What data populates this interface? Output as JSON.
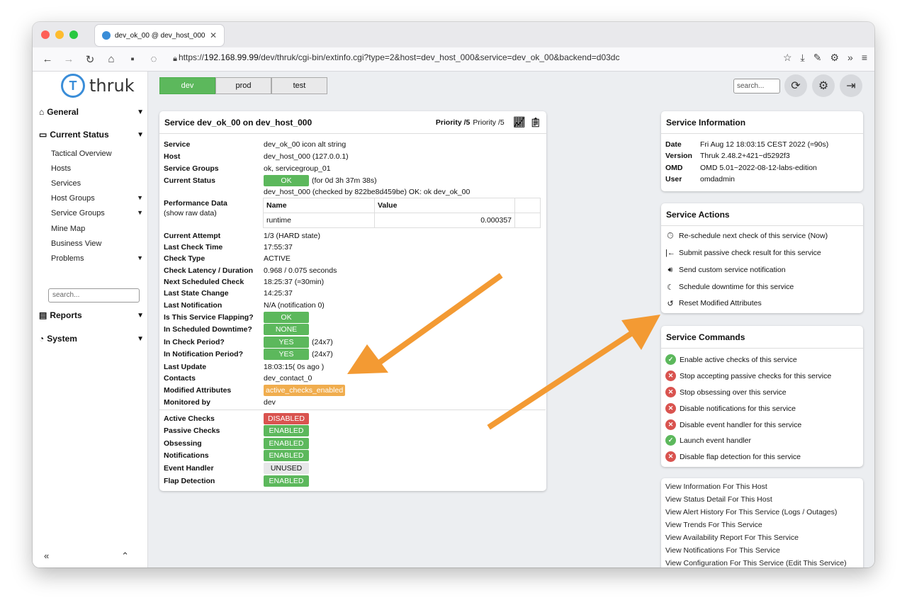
{
  "browser": {
    "tab_title": "dev_ok_00 @ dev_host_000",
    "url_prefix": "https://",
    "url_host": "192.168.99.99",
    "url_path": "/dev/thruk/cgi-bin/extinfo.cgi?type=2&host=dev_host_000&service=dev_ok_00&backend=d03dc"
  },
  "logo": {
    "text": "thruk"
  },
  "sidebar": {
    "sections": [
      {
        "label": "General"
      },
      {
        "label": "Current Status"
      },
      {
        "label": "Reports"
      },
      {
        "label": "System"
      }
    ],
    "items": [
      {
        "label": "Tactical Overview"
      },
      {
        "label": "Hosts"
      },
      {
        "label": "Services"
      },
      {
        "label": "Host Groups"
      },
      {
        "label": "Service Groups"
      },
      {
        "label": "Mine Map"
      },
      {
        "label": "Business View"
      },
      {
        "label": "Problems"
      }
    ],
    "search_placeholder": "search..."
  },
  "backends": [
    "dev",
    "prod",
    "test"
  ],
  "header_search_placeholder": "search...",
  "service_card": {
    "title": "Service dev_ok_00 on dev_host_000",
    "priority_bold": "Priority /5",
    "priority_plain": "Priority /5",
    "rows": {
      "service": {
        "label": "Service",
        "value": "dev_ok_00  icon alt string"
      },
      "host": {
        "label": "Host",
        "value": "dev_host_000 (127.0.0.1)"
      },
      "groups": {
        "label": "Service Groups",
        "value": "ok, servicegroup_01"
      },
      "status": {
        "label": "Current Status",
        "badge": "OK",
        "extra": "(for 0d 3h 37m 38s)",
        "output": "dev_host_000 (checked by 822be8d459be) OK: ok dev_ok_00"
      },
      "perf": {
        "label": "Performance Data",
        "sublabel": "(show raw data)",
        "col_name": "Name",
        "col_value": "Value",
        "name": "runtime",
        "value": "0.000357"
      },
      "attempt": {
        "label": "Current Attempt",
        "value": "1/3 (HARD state)"
      },
      "last_check": {
        "label": "Last Check Time",
        "value": "17:55:37"
      },
      "check_type": {
        "label": "Check Type",
        "value": "ACTIVE"
      },
      "latency": {
        "label": "Check Latency / Duration",
        "value": "0.968 / 0.075 seconds"
      },
      "next_check": {
        "label": "Next Scheduled Check",
        "value": "18:25:37 (≈30min)"
      },
      "last_change": {
        "label": "Last State Change",
        "value": "14:25:37"
      },
      "last_notif": {
        "label": "Last Notification",
        "value": "N/A (notification 0)"
      },
      "flapping": {
        "label": "Is This Service Flapping?",
        "badge": "OK"
      },
      "downtime": {
        "label": "In Scheduled Downtime?",
        "badge": "NONE"
      },
      "check_period": {
        "label": "In Check Period?",
        "badge": "YES",
        "extra": "(24x7)"
      },
      "notif_period": {
        "label": "In Notification Period?",
        "badge": "YES",
        "extra": "(24x7)"
      },
      "last_update": {
        "label": "Last Update",
        "value": "18:03:15( 0s ago )"
      },
      "contacts": {
        "label": "Contacts",
        "value": "dev_contact_0"
      },
      "modified": {
        "label": "Modified Attributes",
        "badge": "active_checks_enabled"
      },
      "monitored": {
        "label": "Monitored by",
        "value": "dev"
      },
      "active_checks": {
        "label": "Active Checks",
        "badge": "DISABLED"
      },
      "passive_checks": {
        "label": "Passive Checks",
        "badge": "ENABLED"
      },
      "obsessing": {
        "label": "Obsessing",
        "badge": "ENABLED"
      },
      "notifications": {
        "label": "Notifications",
        "badge": "ENABLED"
      },
      "event_handler": {
        "label": "Event Handler",
        "badge": "UNUSED"
      },
      "flap": {
        "label": "Flap Detection",
        "badge": "ENABLED"
      }
    }
  },
  "service_info": {
    "title": "Service Information",
    "rows": [
      {
        "k": "Date",
        "v": "Fri Aug 12 18:03:15 CEST 2022 (≈90s)"
      },
      {
        "k": "Version",
        "v": "Thruk 2.48.2+421~d5292f3"
      },
      {
        "k": "OMD",
        "v": "OMD 5.01~2022-08-12-labs-edition"
      },
      {
        "k": "User",
        "v": "omdadmin"
      }
    ]
  },
  "service_actions": {
    "title": "Service Actions",
    "items": [
      {
        "label": "Re-schedule next check of this service (Now)",
        "icon": "clock-icon"
      },
      {
        "label": "Submit passive check result for this service",
        "icon": "arrow-left-bar-icon"
      },
      {
        "label": "Send custom service notification",
        "icon": "speaker-icon"
      },
      {
        "label": "Schedule downtime for this service",
        "icon": "moon-icon"
      },
      {
        "label": "Reset Modified Attributes",
        "icon": "reset-icon"
      }
    ]
  },
  "service_commands": {
    "title": "Service Commands",
    "items": [
      {
        "label": "Enable active checks of this service",
        "icon": "check-circle-icon"
      },
      {
        "label": "Stop accepting passive checks for this service",
        "icon": "x-circle-icon"
      },
      {
        "label": "Stop obsessing over this service",
        "icon": "x-circle-icon"
      },
      {
        "label": "Disable notifications for this service",
        "icon": "x-circle-icon"
      },
      {
        "label": "Disable event handler for this service",
        "icon": "x-circle-icon"
      },
      {
        "label": "Launch event handler",
        "icon": "check-circle-icon"
      },
      {
        "label": "Disable flap detection for this service",
        "icon": "x-circle-icon"
      }
    ]
  },
  "links": [
    "View Information For This Host",
    "View Status Detail For This Host",
    "View Alert History For This Service (Logs / Outages)",
    "View Trends For This Service",
    "View Availability Report For This Service",
    "View Notifications For This Service",
    "View Configuration For This Service (Edit This Service)"
  ],
  "colors": {
    "ok": "#5cb85c",
    "critical": "#d9534f",
    "warning": "#f0ad4e",
    "arrow": "#f39a33",
    "brand": "#3a8dd8"
  }
}
